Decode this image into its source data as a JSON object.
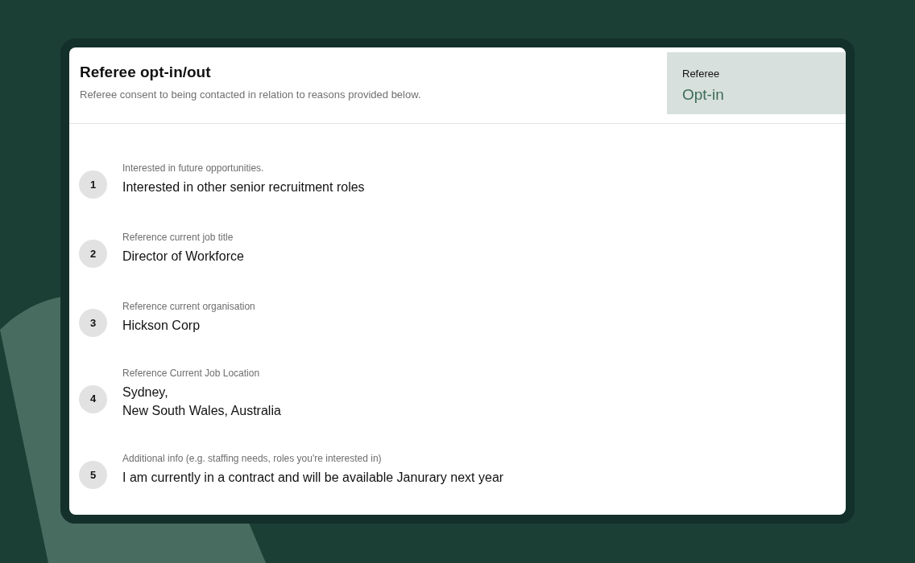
{
  "header": {
    "title": "Referee opt-in/out",
    "subtitle": "Referee consent to being contacted in relation to reasons provided below."
  },
  "status": {
    "label": "Referee",
    "value": "Opt-in"
  },
  "items": [
    {
      "number": "1",
      "question": "Interested in future opportunities.",
      "answer": "Interested in other senior recruitment roles"
    },
    {
      "number": "2",
      "question": "Reference current job title",
      "answer": "Director of Workforce"
    },
    {
      "number": "3",
      "question": "Reference current organisation",
      "answer": "Hickson Corp"
    },
    {
      "number": "4",
      "question": "Reference Current Job Location",
      "answer": "Sydney,\nNew South Wales, Australia"
    },
    {
      "number": "5",
      "question": "Additional info (e.g. staffing needs, roles you're interested in)",
      "answer": "I am currently in a contract and will be available Janurary next year"
    }
  ]
}
